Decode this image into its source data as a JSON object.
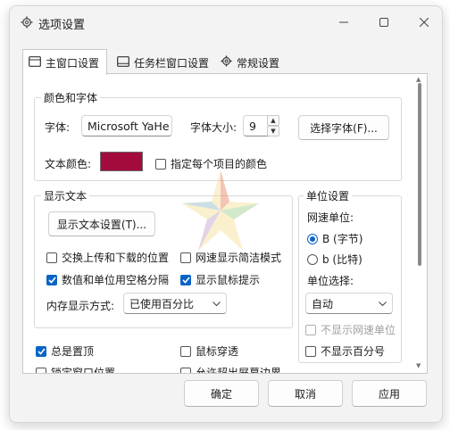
{
  "window": {
    "title": "选项设置"
  },
  "tabs": [
    {
      "label": "主窗口设置",
      "icon": "window-icon",
      "active": true
    },
    {
      "label": "任务栏窗口设置",
      "icon": "taskbar-icon",
      "active": false
    },
    {
      "label": "常规设置",
      "icon": "gear-icon",
      "active": false
    }
  ],
  "color_font": {
    "title": "颜色和字体",
    "font_label": "字体:",
    "font_value": "Microsoft YaHe",
    "size_label": "字体大小:",
    "size_value": "9",
    "choose_font_button": "选择字体(F)...",
    "text_color_label": "文本颜色:",
    "text_color": "#a30b3c",
    "per_item_color_checkbox": "指定每个项目的颜色"
  },
  "display_text": {
    "title": "显示文本",
    "settings_button": "显示文本设置(T)...",
    "swap_checkbox": "交换上传和下载的位置",
    "speed_simple_checkbox": "网速显示简洁模式",
    "space_sep_checkbox": "数值和单位用空格分隔",
    "mouse_tip_checkbox": "显示鼠标提示",
    "memory_label": "内存显示方式:",
    "memory_value": "已使用百分比"
  },
  "unit_settings": {
    "title": "单位设置",
    "speed_unit_label": "网速单位:",
    "unit_byte": "B (字节)",
    "unit_bit": "b (比特)",
    "unit_select_label": "单位选择:",
    "unit_select_value": "自动",
    "hide_speed_unit_checkbox": "不显示网速单位",
    "hide_percent_checkbox": "不显示百分号"
  },
  "misc": {
    "always_top_checkbox": "总是置顶",
    "mouse_through_checkbox": "鼠标穿透",
    "lock_position_checkbox": "锁定窗口位置",
    "allow_offscreen_checkbox": "允许超出屏幕边界"
  },
  "footer": {
    "ok": "确定",
    "cancel": "取消",
    "apply": "应用"
  }
}
